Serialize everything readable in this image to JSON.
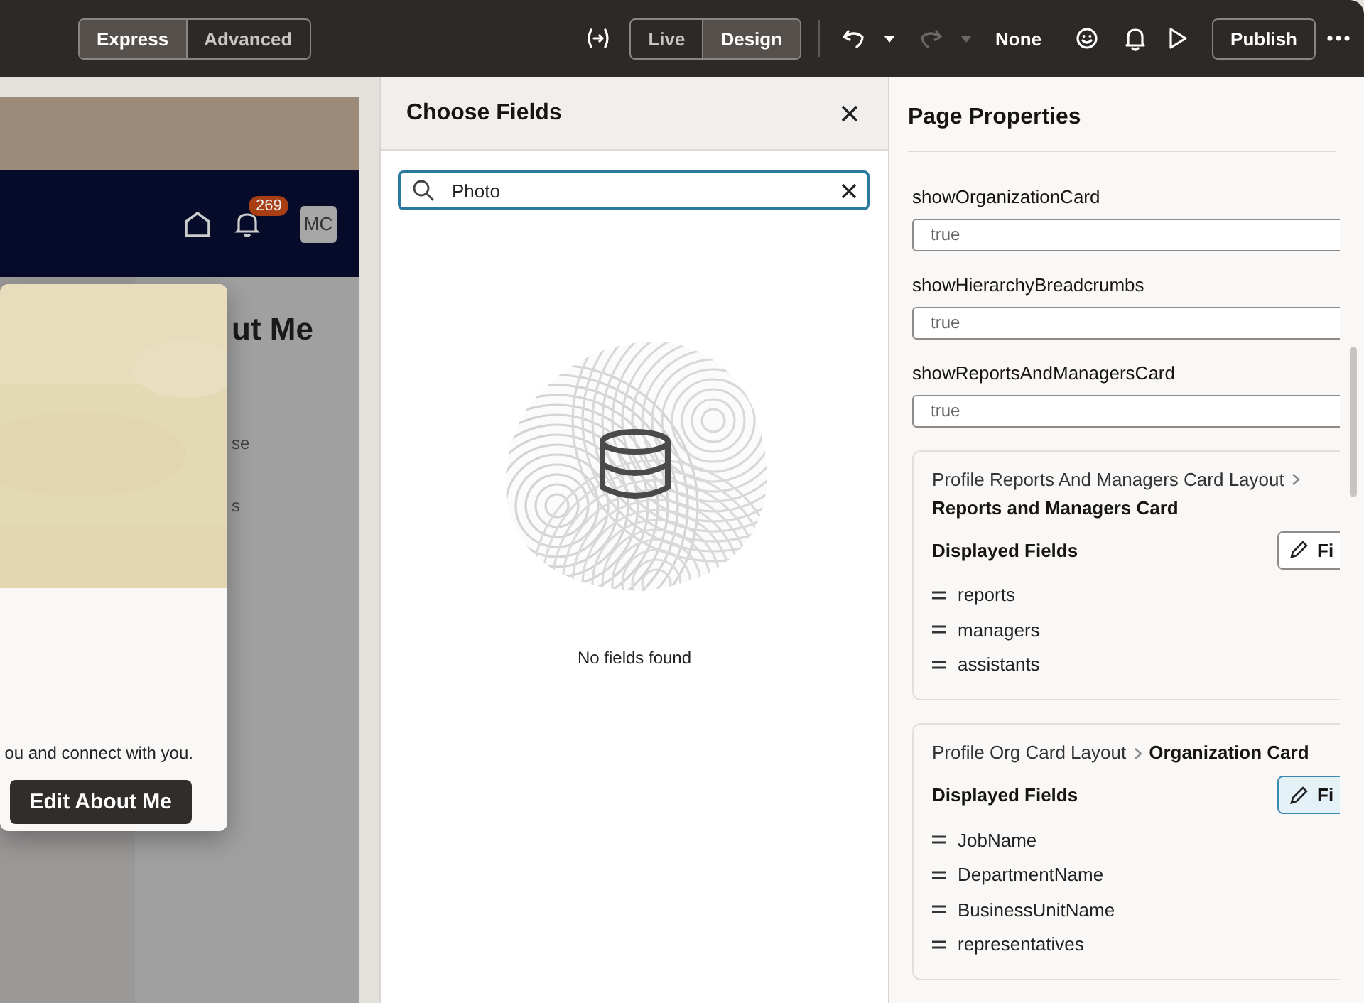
{
  "toolbar": {
    "modes": [
      {
        "label": "Express",
        "selected": true
      },
      {
        "label": "Advanced",
        "selected": false
      }
    ],
    "views": [
      {
        "label": "Live",
        "selected": false
      },
      {
        "label": "Design",
        "selected": true
      }
    ],
    "undo": {
      "disabled": false
    },
    "redo": {
      "disabled": true
    },
    "translation": "None",
    "publish": "Publish"
  },
  "preview": {
    "badge": "269",
    "avatar": "MC",
    "heading": "ut Me",
    "snippets": [
      "se",
      "s"
    ],
    "card_text": "ou and connect with you.",
    "card_button": "Edit About Me"
  },
  "choose_fields": {
    "title": "Choose Fields",
    "search": {
      "value": "Photo"
    },
    "empty_message": "No fields found"
  },
  "page_properties": {
    "title": "Page Properties",
    "properties": [
      {
        "label": "showOrganizationCard",
        "value": "true"
      },
      {
        "label": "showHierarchyBreadcrumbs",
        "value": "true"
      },
      {
        "label": "showReportsAndManagersCard",
        "value": "true"
      }
    ],
    "cards": [
      {
        "parent": "Profile Reports And Managers Card Layout",
        "current": "Reports and Managers Card",
        "fields_label": "Displayed Fields",
        "button": "Fi",
        "focused": false,
        "fields": [
          "reports",
          "managers",
          "assistants"
        ]
      },
      {
        "parent": "Profile Org Card Layout",
        "current": "Organization Card",
        "fields_label": "Displayed Fields",
        "button": "Fi",
        "focused": true,
        "fields": [
          "JobName",
          "DepartmentName",
          "BusinessUnitName",
          "representatives"
        ]
      }
    ]
  }
}
